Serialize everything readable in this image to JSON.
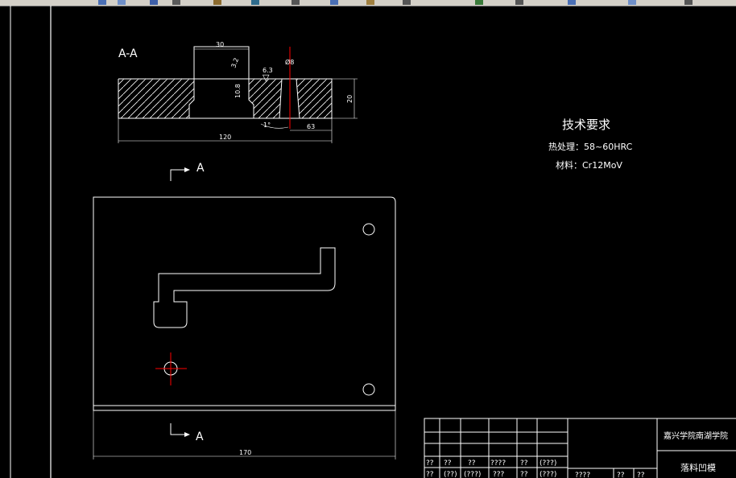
{
  "toolbar": {
    "icons": [
      "new-file-icon",
      "open-icon",
      "save-icon",
      "print-icon",
      "undo-icon",
      "redo-icon",
      "cut-icon",
      "copy-icon",
      "paste-icon",
      "pan-icon",
      "zoom-icon",
      "properties-icon",
      "layer-icon",
      "block-icon",
      "help-icon"
    ]
  },
  "section": {
    "title": "A-A",
    "dims": {
      "top_width": "30",
      "depth": "3.2",
      "inner_height": "10.8",
      "roughness": "6.3",
      "hole_dia": "Ø8",
      "thickness": "20",
      "angle": "1°",
      "offset": "63",
      "width": "120"
    }
  },
  "cut_marks": {
    "top_label": "A",
    "bottom_label": "A"
  },
  "plan_view": {
    "width_dim": "170"
  },
  "tech": {
    "heading": "技术要求",
    "heat_treatment": "热处理：58~60HRC",
    "material": "材料：Cr12MoV"
  },
  "title_block": {
    "school": "嘉兴学院南湖学院",
    "part_name": "落料凹模",
    "row1": [
      "??",
      "??",
      "??",
      "????",
      "??",
      "(???)"
    ],
    "row2": [
      "??",
      "(??)",
      "(???)",
      "???",
      "??",
      "(???)"
    ],
    "row2_right": [
      "????",
      "??",
      "??"
    ]
  },
  "colors": {
    "background": "#000000",
    "lines": "#ffffff",
    "center_mark": "#ff0000"
  }
}
